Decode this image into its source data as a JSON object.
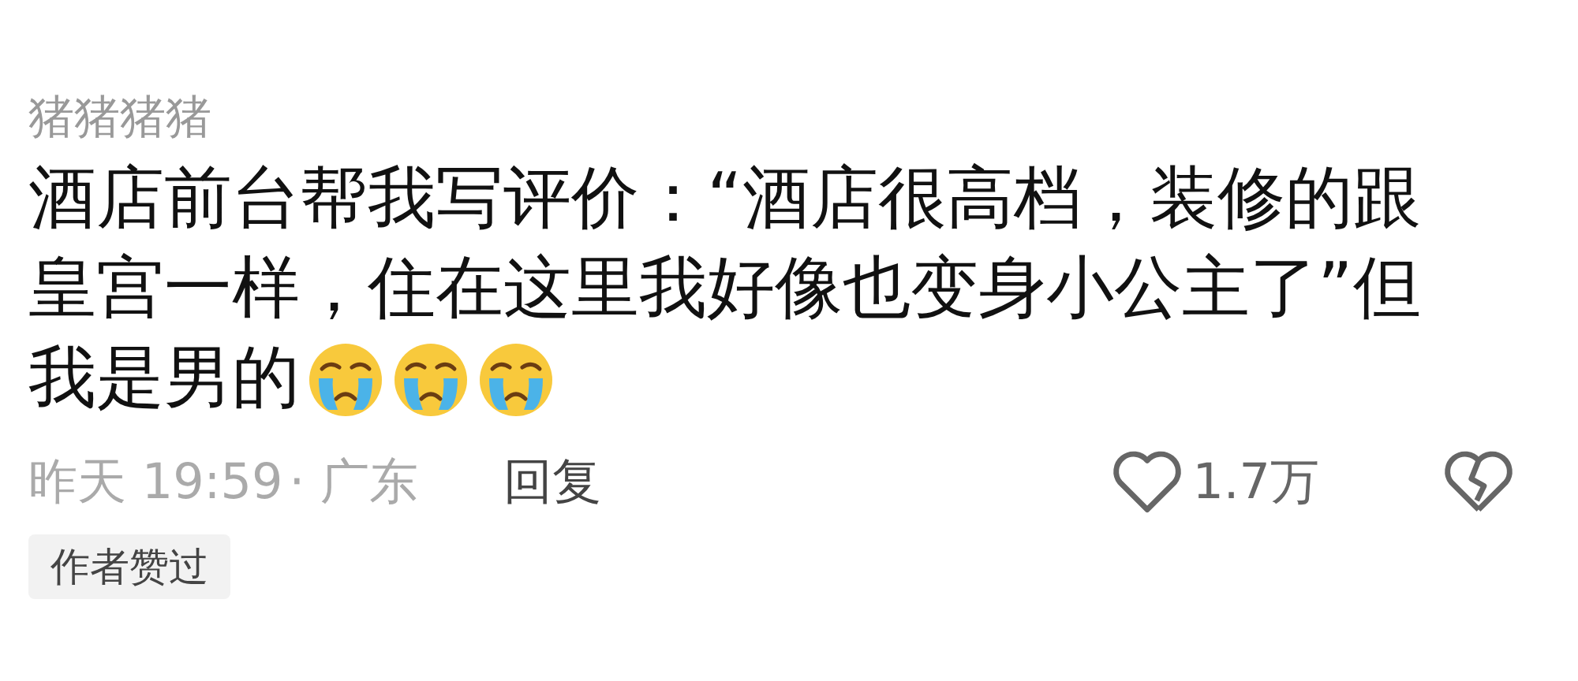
{
  "comment": {
    "username": "猪猪猪猪",
    "text_lines": [
      "酒店前台帮我写评价：“酒店很高档，装修的跟",
      "皇宫一样，住在这里我好像也变身小公主了”但",
      "我是男的"
    ],
    "emojis": [
      {
        "kind": "crying"
      },
      {
        "kind": "crying"
      },
      {
        "kind": "crying"
      }
    ],
    "time": "昨天 19:59",
    "location": "· 广东",
    "reply_label": "回复",
    "likes": "1.7万",
    "liked": false,
    "badge": "作者赞过"
  }
}
